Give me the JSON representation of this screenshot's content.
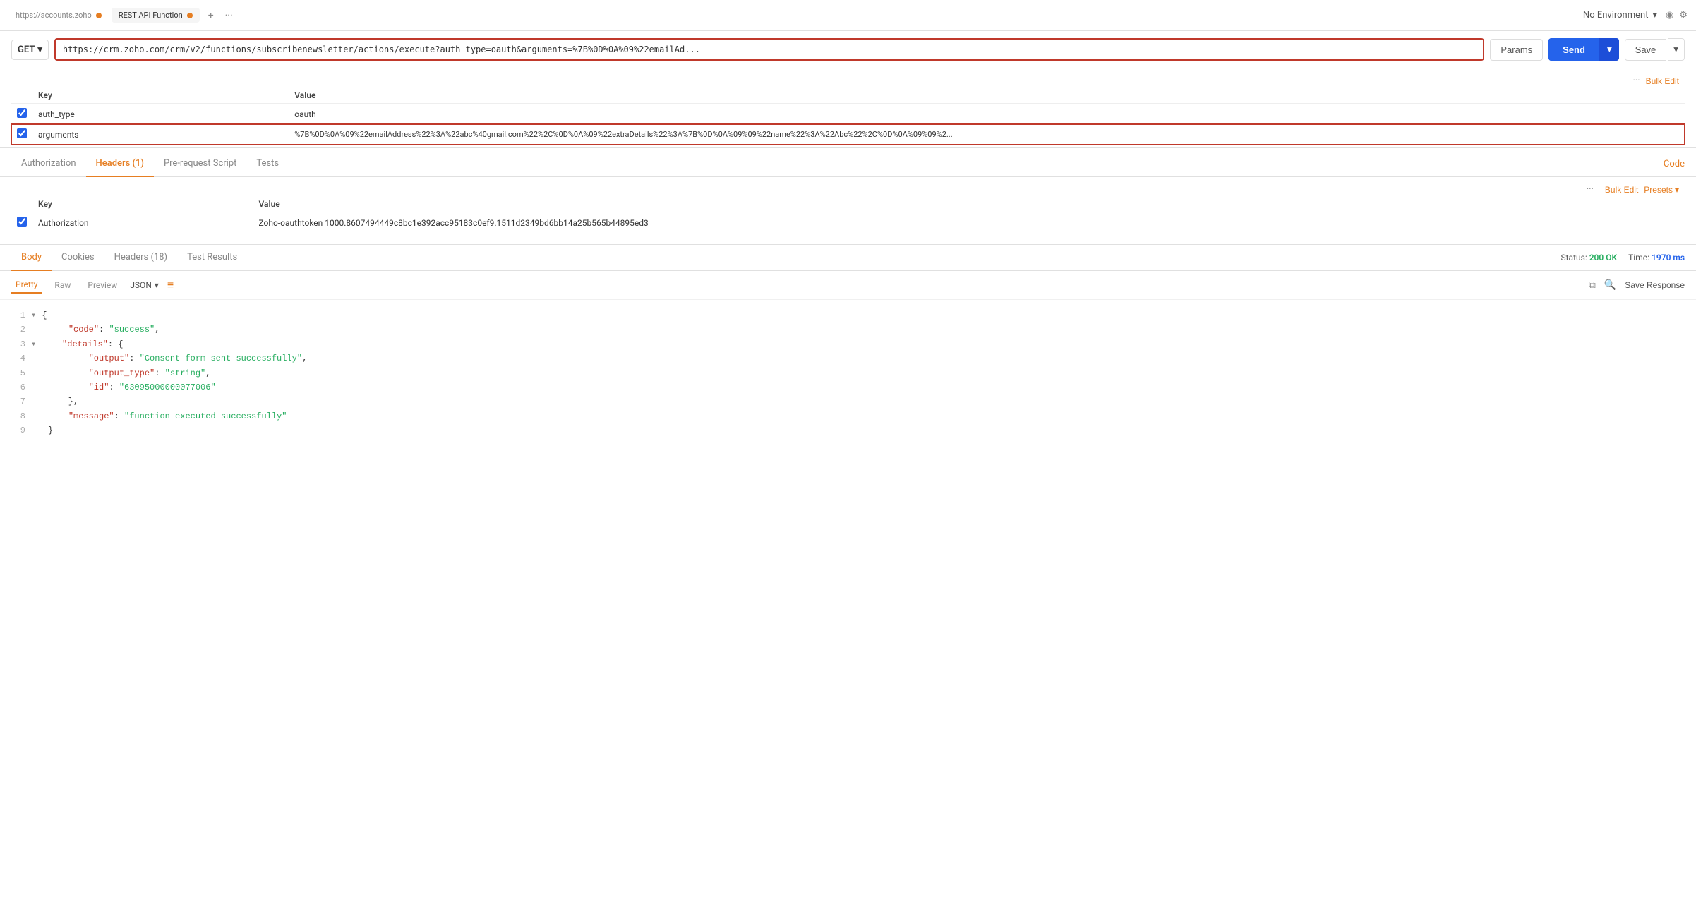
{
  "tabBar": {
    "tabs": [
      {
        "id": "accounts",
        "label": "https://accounts.zoho",
        "dotColor": "#e67e22",
        "active": false
      },
      {
        "id": "rest-api",
        "label": "REST API Function",
        "dotColor": "#e67e22",
        "active": true
      }
    ],
    "addTabLabel": "+",
    "moreLabel": "···",
    "environment": {
      "label": "No Environment",
      "chevronIcon": "▾"
    },
    "eyeIcon": "👁",
    "gearIcon": "⚙"
  },
  "urlBar": {
    "method": "GET",
    "url": "https://crm.zoho.com/crm/v2/functions/subscribenewsletter/actions/execute?auth_type=oauth&arguments=%7B%0D%0A%09%22emailAd...",
    "paramsBtn": "Params",
    "sendBtn": "Send",
    "saveBtn": "Save"
  },
  "paramsTable": {
    "headers": [
      "Key",
      "Value"
    ],
    "bulkEditLabel": "Bulk Edit",
    "moreDotsLabel": "···",
    "rows": [
      {
        "checked": true,
        "key": "auth_type",
        "value": "oauth",
        "highlighted": false
      },
      {
        "checked": true,
        "key": "arguments",
        "value": "%7B%0D%0A%09%22emailAddress%22%3A%22abc%40gmail.com%22%2C%0D%0A%09%22extraDetails%22%3A%7B%0D%0A%09%09%22name%22%3A%22Abc%22%2C%0D%0A%09%09%2...",
        "highlighted": true
      }
    ]
  },
  "requestTabs": {
    "tabs": [
      {
        "id": "authorization",
        "label": "Authorization",
        "active": false
      },
      {
        "id": "headers",
        "label": "Headers (1)",
        "active": true
      },
      {
        "id": "pre-request",
        "label": "Pre-request Script",
        "active": false
      },
      {
        "id": "tests",
        "label": "Tests",
        "active": false
      }
    ],
    "codeLink": "Code"
  },
  "headersTable": {
    "headers": [
      "Key",
      "Value"
    ],
    "bulkEditLabel": "Bulk Edit",
    "presetsLabel": "Presets",
    "moreDotsLabel": "···",
    "rows": [
      {
        "checked": true,
        "key": "Authorization",
        "value": "Zoho-oauthtoken 1000.8607494449c8bc1e392acc95183c0ef9.1511d2349bd6bb14a25b565b44895ed3"
      }
    ]
  },
  "responseTabs": {
    "tabs": [
      {
        "id": "body",
        "label": "Body",
        "active": true
      },
      {
        "id": "cookies",
        "label": "Cookies",
        "active": false
      },
      {
        "id": "headers",
        "label": "Headers (18)",
        "active": false
      },
      {
        "id": "test-results",
        "label": "Test Results",
        "active": false
      }
    ],
    "status": {
      "statusLabel": "Status:",
      "statusValue": "200 OK",
      "timeLabel": "Time:",
      "timeValue": "1970 ms"
    }
  },
  "responseFormat": {
    "tabs": [
      {
        "id": "pretty",
        "label": "Pretty",
        "active": true
      },
      {
        "id": "raw",
        "label": "Raw",
        "active": false
      },
      {
        "id": "preview",
        "label": "Preview",
        "active": false
      }
    ],
    "format": "JSON",
    "saveResponseLabel": "Save Response"
  },
  "jsonOutput": {
    "lines": [
      {
        "num": "1",
        "content": "{",
        "indent": 0,
        "collapse": true
      },
      {
        "num": "2",
        "content": "  \"code\": \"success\",",
        "indent": 1,
        "key": "code",
        "val": "success"
      },
      {
        "num": "3",
        "content": "  \"details\": {",
        "indent": 1,
        "collapse": true
      },
      {
        "num": "4",
        "content": "    \"output\": \"Consent form sent successfully\",",
        "indent": 2,
        "key": "output",
        "val": "Consent form sent successfully"
      },
      {
        "num": "5",
        "content": "    \"output_type\": \"string\",",
        "indent": 2,
        "key": "output_type",
        "val": "string"
      },
      {
        "num": "6",
        "content": "    \"id\": \"63095000000077006\"",
        "indent": 2,
        "key": "id",
        "val": "63095000000077006"
      },
      {
        "num": "7",
        "content": "  },",
        "indent": 1
      },
      {
        "num": "8",
        "content": "  \"message\": \"function executed successfully\"",
        "indent": 1,
        "key": "message",
        "val": "function executed successfully"
      },
      {
        "num": "9",
        "content": "}",
        "indent": 0
      }
    ]
  },
  "icons": {
    "chevronDown": "▾",
    "chevronRight": "▸",
    "eye": "◉",
    "gear": "⚙",
    "copy": "⧉",
    "search": "🔍",
    "wrapLines": "≡"
  }
}
